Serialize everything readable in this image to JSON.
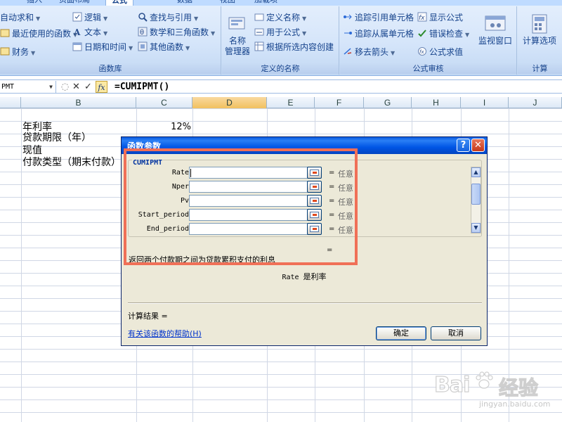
{
  "tabs": [
    {
      "label": "插入"
    },
    {
      "label": "页面布局"
    },
    {
      "label": "公式"
    },
    {
      "label": "数据"
    },
    {
      "label": "审阅"
    },
    {
      "label": "视图"
    },
    {
      "label": "加载项"
    }
  ],
  "ribbon": {
    "function_library": {
      "label": "函数库",
      "autosum": "自动求和",
      "recent": "最近使用的函数",
      "financial": "财务",
      "logical": "逻辑",
      "text": "文本",
      "datetime": "日期和时间",
      "lookup": "查找与引用",
      "math": "数学和三角函数",
      "more": "其他函数"
    },
    "defined_names": {
      "label": "定义的名称",
      "name_manager": "名称\n管理器",
      "define_name": "定义名称",
      "use_in_formula": "用于公式",
      "create_from_selection": "根据所选内容创建"
    },
    "formula_auditing": {
      "label": "公式审核",
      "trace_precedents": "追踪引用单元格",
      "trace_dependents": "追踪从属单元格",
      "remove_arrows": "移去箭头",
      "show_formulas": "显示公式",
      "error_checking": "错误检查",
      "evaluate_formula": "公式求值",
      "watch_window": "监视窗口"
    },
    "calculation": {
      "label": "计算",
      "options": "计算选项"
    }
  },
  "formula_bar": {
    "name_box": "PMT",
    "formula": "=CUMIPMT()"
  },
  "sheet": {
    "columns": [
      "B",
      "C",
      "D",
      "E",
      "F",
      "G",
      "H",
      "I",
      "J"
    ],
    "selected_column": "D",
    "cells": [
      {
        "label": "年利率",
        "value": "12%"
      },
      {
        "label": "贷款期限（年）",
        "value": ""
      },
      {
        "label": "现值",
        "value": ""
      },
      {
        "label": "付款类型（期末付款）",
        "value": ""
      }
    ]
  },
  "dialog": {
    "title": "函数参数",
    "function_name": "CUMIPMT",
    "args": [
      {
        "name": "Rate",
        "value": "",
        "hint": "任意"
      },
      {
        "name": "Nper",
        "value": "",
        "hint": "任意"
      },
      {
        "name": "Pv",
        "value": "",
        "hint": "任意"
      },
      {
        "name": "Start_period",
        "value": "",
        "hint": "任意"
      },
      {
        "name": "End_period",
        "value": "",
        "hint": "任意"
      }
    ],
    "equals": "=",
    "result_equals": "=",
    "description": "返回两个付款期之间为贷款累积支付的利息",
    "arg_desc_name": "Rate",
    "arg_desc_text": "是利率",
    "calc_result_label": "计算结果 =",
    "help_link": "有关该函数的帮助(H)",
    "ok": "确定",
    "cancel": "取消",
    "help_symbol": "?",
    "close_symbol": "✕"
  },
  "watermark": {
    "brand": "Bai",
    "brand_cn": "经验",
    "url": "jingyan.baidu.com"
  },
  "colors": {
    "ribbon_bg": "#d5e5fa",
    "dialog_title": "#0055e5",
    "highlight": "#f07057",
    "selected_col": "#f1c15f"
  }
}
